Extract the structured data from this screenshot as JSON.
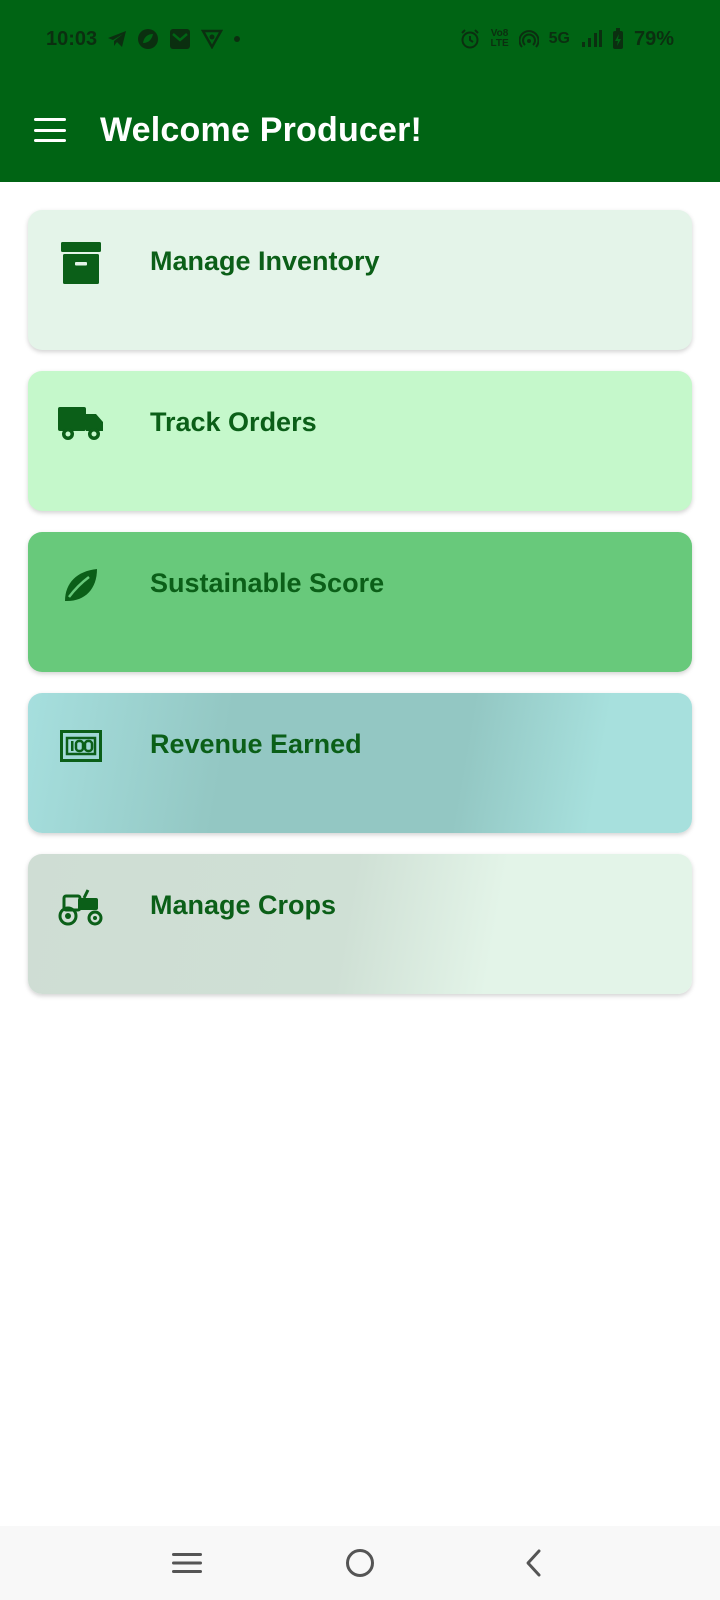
{
  "status_bar": {
    "time": "10:03",
    "volte_top": "Vo8",
    "volte_bottom": "LTE",
    "network": "5G",
    "battery": "79%"
  },
  "app_bar": {
    "title": "Welcome Producer!",
    "menu_icon": "hamburger-menu-icon"
  },
  "cards": [
    {
      "label": "Manage Inventory",
      "icon": "archive-box-icon",
      "color": "#e4f4e9"
    },
    {
      "label": "Track Orders",
      "icon": "truck-icon",
      "color": "#c5f8cb"
    },
    {
      "label": "Sustainable Score",
      "icon": "leaf-icon",
      "color": "#68c97b"
    },
    {
      "label": "Revenue Earned",
      "icon": "money-bill-icon",
      "color": "#93c7c3"
    },
    {
      "label": "Manage Crops",
      "icon": "tractor-icon",
      "color": "#cfddd4"
    }
  ],
  "nav_bar": {
    "recents_icon": "recents-icon",
    "home_icon": "home-circle-icon",
    "back_icon": "back-chevron-icon"
  },
  "colors": {
    "primary": "#006414",
    "card_text": "#0b5f18"
  }
}
